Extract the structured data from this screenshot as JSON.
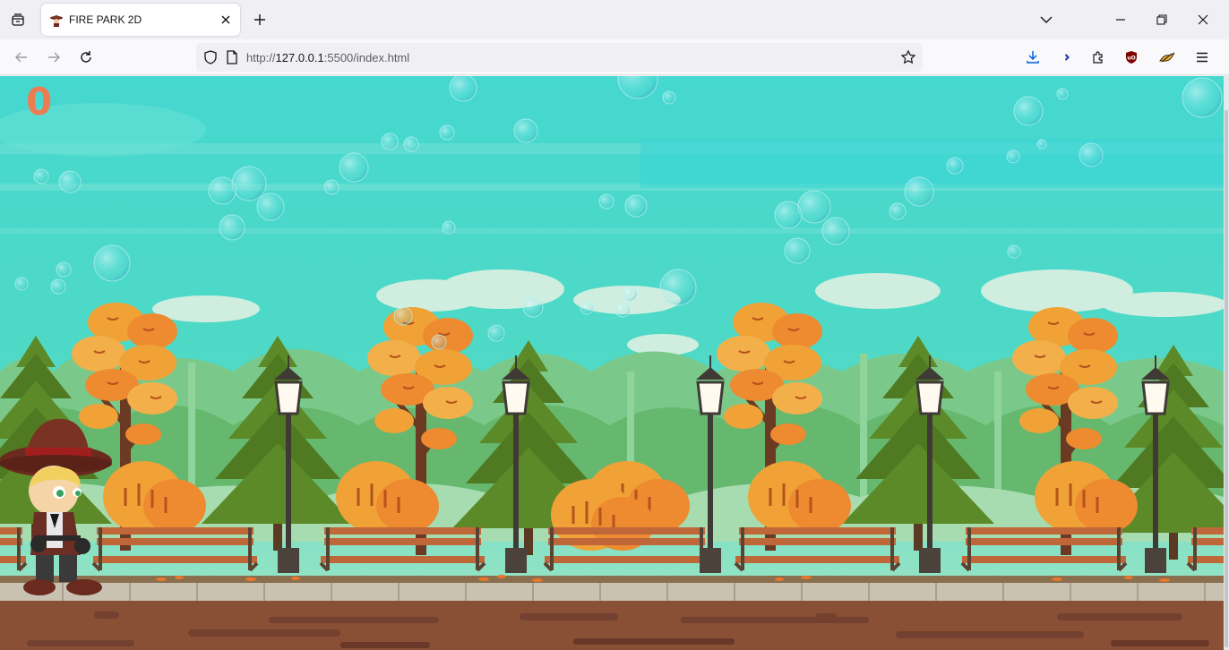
{
  "browser": {
    "tab": {
      "title": "FIRE PARK 2D",
      "favicon": "cowboy-hat-favicon"
    },
    "url": {
      "prefix": "http://",
      "host": "127.0.0.1",
      "rest": ":5500/index.html"
    },
    "icons": {
      "tab_list": "tab-list-icon",
      "close_tab": "close-icon",
      "new_tab": "plus-icon",
      "dropdown": "chevron-down-icon",
      "minimize": "minimize-icon",
      "restore": "restore-icon",
      "close_window": "close-icon",
      "back": "back-arrow-icon",
      "forward": "forward-arrow-icon",
      "reload": "reload-icon",
      "shield": "shield-icon",
      "page": "page-icon",
      "bookmark": "star-icon",
      "downloads": "download-icon",
      "bitwarden": "extension-blue-icon",
      "extensions": "puzzle-icon",
      "ublock": "ublock-icon",
      "extension_bird": "extension-bird-icon",
      "menu": "hamburger-menu-icon"
    }
  },
  "game": {
    "score": "0",
    "colors": {
      "sky": "#42d9d0",
      "score": "#ec7d52",
      "leaves": "#f0a237",
      "pine": "#4f7a22",
      "bench": "#c0673a",
      "ground": "#8a5036"
    }
  }
}
